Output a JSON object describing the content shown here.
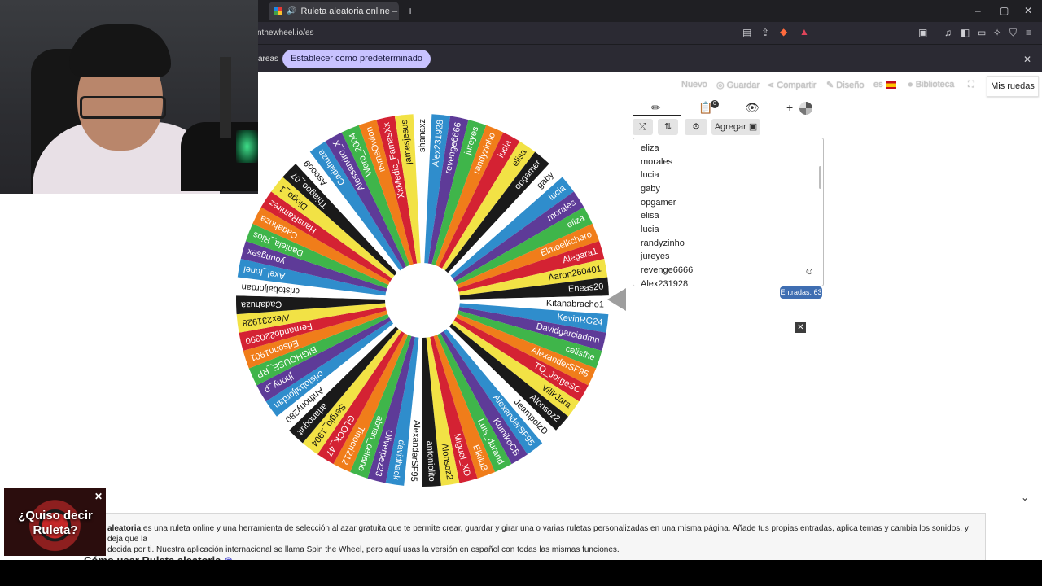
{
  "browser": {
    "tab_title": "Ruleta aleatoria online – ruleta",
    "new_tab": "+",
    "url": "nthewheel.io/es",
    "window_controls": [
      "–",
      "▢",
      "✕"
    ]
  },
  "infobar": {
    "left_text": "areas",
    "default_button": "Establecer como predeterminado",
    "close": "✕"
  },
  "top_nav": {
    "nuevo": "Nuevo",
    "guardar": "Guardar",
    "compartir": "Compartir",
    "diseno": "Diseño",
    "lang": "es",
    "biblioteca": "Biblioteca",
    "mis_ruedas": "Mis ruedas"
  },
  "panel": {
    "agregar": "Agregar",
    "entries_count": "Entradas: 63",
    "entries": [
      "eliza",
      "morales",
      "lucia",
      "gaby",
      "opgamer",
      "elisa",
      "lucia",
      "randyzinho",
      "jureyes",
      "revenge6666",
      "Alex231928"
    ]
  },
  "wheel": {
    "segments": [
      "shanaxz",
      "Alex231928",
      "revenge6666",
      "jureyes",
      "randyzinho",
      "lucia",
      "elisa",
      "opgamer",
      "gaby",
      "lucia",
      "morales",
      "eliza",
      "Elmoelkchero",
      "Alegara1",
      "Aaron260401",
      "Eneas20",
      "Kitanabracho1",
      "KevinRG24",
      "Davidgarciadmn",
      "celisfhe",
      "AlexanderSF95",
      "TQ_JorgeSC",
      "VilikJara",
      "Alonsoz2",
      "JeampolzD",
      "AlexanderSF95",
      "KumikoCB",
      "Luis_durand",
      "ElkiluB",
      "Miguel_XD",
      "Alonsoz2",
      "antoniolito",
      "AlexanderSF95",
      "davidhack",
      "Oliverpez23",
      "abrian_celiano",
      "Tinocri212",
      "GLOCK_47",
      "Sergio_1904",
      "arianoquit",
      "Anthony280",
      "cristobaljordan",
      "jhony_p",
      "BIGHOUSE_RP",
      "Edsonn1901",
      "Fernando220390",
      "Alex231928",
      "Cadahuza",
      "cristobaljordan",
      "Axel_Ionel",
      "youngsex",
      "Daniela_Rios",
      "Cadahuza",
      "HansRamirez",
      "Diogo_1",
      "Thiagoo_07",
      "Asooo9",
      "Cadahuza",
      "Alessandro_X",
      "Wero_2004",
      "itsmeOwlon",
      "XxMedic_FamasXx",
      "jamesjesus"
    ],
    "colors": [
      "#ffffff",
      "#2f8dcc",
      "#5e3b98",
      "#3fb54a",
      "#f07d1a",
      "#d42233",
      "#f2e245",
      "#1a1a1a"
    ]
  },
  "overlay": {
    "promo_text": "¿Quiso decir Ruleta?",
    "promo_close": "✕"
  },
  "description": {
    "bold": "aleatoria",
    "text": " es una ruleta online y una herramienta de selección al azar gratuita que te permite crear, guardar y girar una o varias ruletas personalizadas en una misma página. Añade tus propias entradas, aplica temas y cambia los sonidos, y deja que la",
    "text2": "decida por ti. Nuestra aplicación internacional se llama Spin the Wheel, pero aquí usas la versión en español con todas las mismas funciones.",
    "howto": "Cómo usar Ruleta aleatoria"
  }
}
